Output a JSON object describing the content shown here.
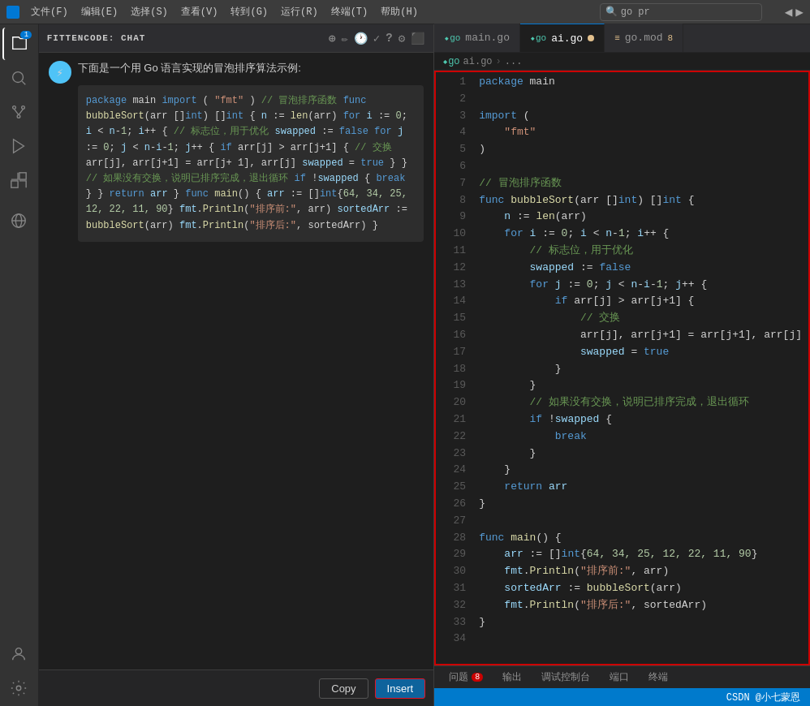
{
  "titlebar": {
    "menus": [
      "文件(F)",
      "编辑(E)",
      "选择(S)",
      "查看(V)",
      "转到(G)",
      "运行(R)",
      "终端(T)",
      "帮助(H)"
    ],
    "search_placeholder": "go pr"
  },
  "activity": {
    "icons": [
      "explorer",
      "search",
      "source-control",
      "run-debug",
      "extensions",
      "remote",
      "account",
      "settings"
    ]
  },
  "side_panel": {
    "title": "FITTENCODE: CHAT",
    "intro_text": "下面是一个用 Go 语言实现的冒泡排序算法示例:",
    "buttons": {
      "copy": "Copy",
      "insert": "Insert"
    }
  },
  "editor": {
    "tabs": [
      {
        "name": "main.go",
        "icon": "go",
        "active": false,
        "modified": false
      },
      {
        "name": "ai.go",
        "icon": "go",
        "active": true,
        "modified": true
      },
      {
        "name": "go.mod",
        "icon": "mod",
        "active": false,
        "modified": true,
        "count": "8"
      }
    ],
    "breadcrumb": [
      "ai.go",
      "..."
    ]
  },
  "bottom_tabs": {
    "items": [
      "问题",
      "输出",
      "调试控制台",
      "端口",
      "终端"
    ],
    "problem_count": "8"
  },
  "status_bar": {
    "watermark": "CSDN @小七蒙恩"
  },
  "code": {
    "lines": [
      "package main",
      "",
      "import (",
      "    \"fmt\"",
      ")",
      "",
      "// 冒泡排序函数",
      "func bubbleSort(arr []int) []int {",
      "    n := len(arr)",
      "    for i := 0; i < n-1; i++ {",
      "        // 标志位，用于优化",
      "        swapped := false",
      "        for j := 0; j < n-i-1; j++ {",
      "            if arr[j] > arr[j+1] {",
      "                // 交换",
      "                arr[j], arr[j+1] = arr[j+1], arr[j]",
      "                swapped = true",
      "            }",
      "        }",
      "        // 如果没有交换，说明已排序完成，退出循环",
      "        if !swapped {",
      "            break",
      "        }",
      "    }",
      "    return arr",
      "}",
      "",
      "func main() {",
      "    arr := []int{64, 34, 25, 12, 22, 11, 90}",
      "    fmt.Println(\"排序前:\", arr)",
      "    sortedArr := bubbleSort(arr)",
      "    fmt.Println(\"排序后:\", sortedArr)",
      "}",
      ""
    ]
  }
}
